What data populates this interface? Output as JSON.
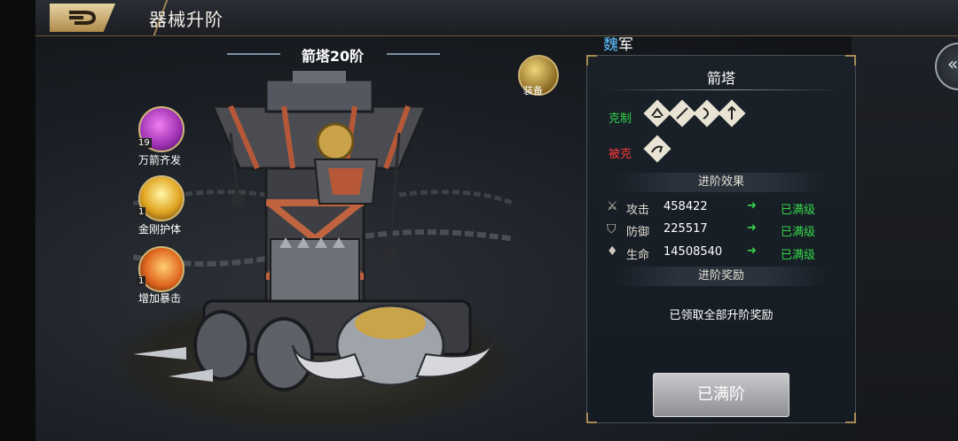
{
  "header": {
    "title": "器械升阶"
  },
  "tower": {
    "title": "箭塔20阶"
  },
  "equip": {
    "label": "装备"
  },
  "skills": [
    {
      "name": "万箭齐发",
      "level": "19"
    },
    {
      "name": "金刚护体",
      "level": "1"
    },
    {
      "name": "增加暴击",
      "level": "1"
    }
  ],
  "faction": {
    "name": "魏",
    "suffix": "军"
  },
  "panel": {
    "name": "箭塔",
    "counter_label": "克制",
    "countered_label": "被克",
    "counter_icons": [
      "siege-icon",
      "spear-icon",
      "bow-icon",
      "archer-icon"
    ],
    "countered_icons": [
      "cavalry-icon"
    ],
    "advance_effect_title": "进阶效果",
    "stats": [
      {
        "icon": "swords-icon",
        "label": "攻击",
        "value": "458422",
        "status": "已满级"
      },
      {
        "icon": "shield-icon",
        "label": "防御",
        "value": "225517",
        "status": "已满级"
      },
      {
        "icon": "drop-icon",
        "label": "生命",
        "value": "14508540",
        "status": "已满级"
      }
    ],
    "advance_reward_title": "进阶奖励",
    "reward_text": "已领取全部升阶奖励",
    "max_button": "已满阶"
  },
  "colors": {
    "counter": "#2fd44a",
    "countered": "#ff3a3a",
    "status": "#35d64a",
    "accent": "#cbb171"
  }
}
